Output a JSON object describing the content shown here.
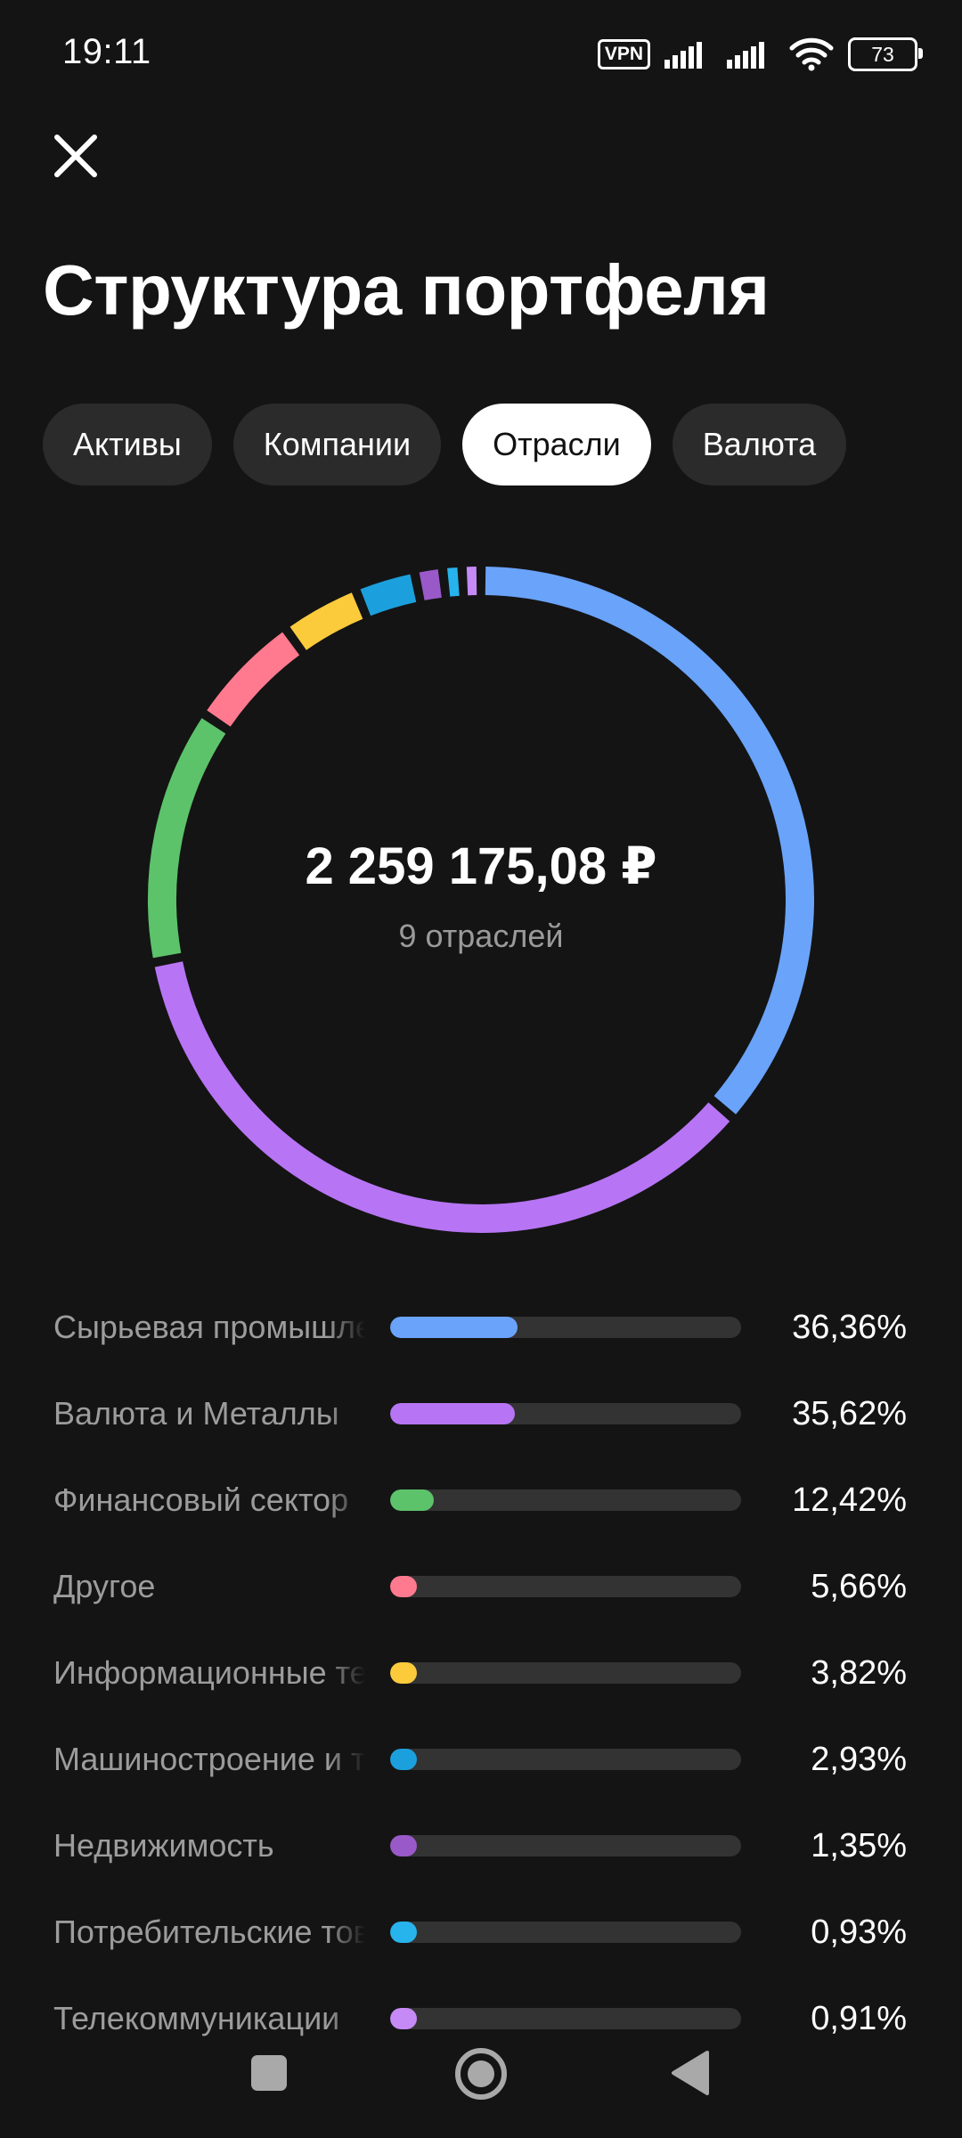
{
  "status_bar": {
    "time": "19:11",
    "vpn_label": "VPN",
    "battery_level": "73",
    "icons": [
      "vpn-icon",
      "signal-icon",
      "signal-icon",
      "wifi-icon",
      "battery-icon"
    ]
  },
  "header": {
    "close_icon": "close-icon",
    "title": "Структура портфеля"
  },
  "tabs": [
    {
      "label": "Активы",
      "active": false
    },
    {
      "label": "Компании",
      "active": false
    },
    {
      "label": "Отрасли",
      "active": true
    },
    {
      "label": "Валюта",
      "active": false
    }
  ],
  "summary": {
    "total": "2 259 175,08 ₽",
    "caption": "9 отраслей"
  },
  "chart_data": {
    "type": "pie",
    "style": "donut",
    "categories": [
      "Сырьевая промышленность",
      "Валюта и Металлы",
      "Финансовый сектор",
      "Другое",
      "Информационные технологии",
      "Машиностроение и транспорт",
      "Недвижимость",
      "Потребительские товары",
      "Телекоммуникации"
    ],
    "values": [
      36.36,
      35.62,
      12.42,
      5.66,
      3.82,
      2.93,
      1.35,
      0.93,
      0.91
    ],
    "labels": [
      "36,36%",
      "35,62%",
      "12,42%",
      "5,66%",
      "3,82%",
      "2,93%",
      "1,35%",
      "0,93%",
      "0,91%"
    ],
    "colors": [
      "#6aa3fa",
      "#b775f5",
      "#5cc36b",
      "#ff7a8f",
      "#fbcb3c",
      "#1ba0dd",
      "#9a59c9",
      "#27b3ec",
      "#c68af7"
    ],
    "unit": "%"
  }
}
